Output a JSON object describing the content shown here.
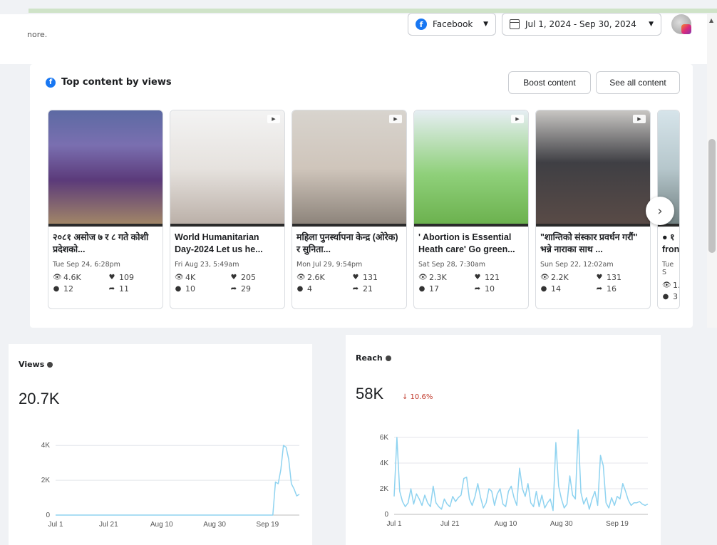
{
  "header": {
    "more_text": "nore.",
    "platform": "Facebook",
    "date_range": "Jul 1, 2024 - Sep 30, 2024"
  },
  "top_content": {
    "title": "Top content by views",
    "boost_label": "Boost content",
    "see_all_label": "See all content",
    "cards": [
      {
        "title": "२०८१ असोज ७ र ८ गते कोशी प्रदेशको...",
        "date": "Tue Sep 24, 6:28pm",
        "views": "4.6K",
        "reactions": "109",
        "comments": "12",
        "shares": "11"
      },
      {
        "title": "World Humanitarian Day-2024 Let us he...",
        "date": "Fri Aug 23, 5:49am",
        "views": "4K",
        "reactions": "205",
        "comments": "10",
        "shares": "29"
      },
      {
        "title": "महिला पुनर्स्थापना केन्द्र (ओरेक) र सुनिता...",
        "date": "Mon Jul 29, 9:54pm",
        "views": "2.6K",
        "reactions": "131",
        "comments": "4",
        "shares": "21"
      },
      {
        "title": "' Abortion is Essential Heath care' Go green...",
        "date": "Sat Sep 28, 7:30am",
        "views": "2.3K",
        "reactions": "121",
        "comments": "17",
        "shares": "10"
      },
      {
        "title": "\"शान्तिको संस्कार प्रवर्धन गरौं\" भन्ने नाराका साथ ...",
        "date": "Sun Sep 22, 12:02am",
        "views": "2.2K",
        "reactions": "131",
        "comments": "14",
        "shares": "16"
      },
      {
        "title": "● १ fron",
        "date": "Tue S",
        "views": "1.",
        "reactions": "",
        "comments": "3",
        "shares": ""
      }
    ]
  },
  "views": {
    "title": "Views",
    "value": "20.7K"
  },
  "reach": {
    "title": "Reach",
    "value": "58K",
    "delta": "↓ 10.6%"
  },
  "colors": {
    "accent": "#1877f2",
    "line": "#8fd3f0",
    "negative": "#c0392b"
  },
  "chart_data": [
    {
      "type": "line",
      "title": "Views",
      "x_ticks": [
        "Jul 1",
        "Jul 21",
        "Aug 10",
        "Aug 30",
        "Sep 19"
      ],
      "y_ticks": [
        "0",
        "2K",
        "4K"
      ],
      "ylim": [
        0,
        4500
      ],
      "x_start": "2024-07-01",
      "values": [
        0,
        0,
        0,
        0,
        0,
        0,
        0,
        0,
        0,
        0,
        0,
        0,
        0,
        0,
        0,
        0,
        0,
        0,
        0,
        0,
        0,
        0,
        0,
        0,
        0,
        0,
        0,
        0,
        0,
        0,
        0,
        0,
        0,
        0,
        0,
        0,
        0,
        0,
        0,
        0,
        0,
        0,
        0,
        0,
        0,
        0,
        0,
        0,
        0,
        0,
        0,
        0,
        0,
        0,
        0,
        0,
        0,
        0,
        0,
        0,
        0,
        0,
        0,
        0,
        0,
        0,
        0,
        0,
        0,
        0,
        0,
        0,
        0,
        0,
        0,
        0,
        0,
        0,
        0,
        0,
        0,
        0,
        0,
        1900,
        1800,
        2600,
        4000,
        3900,
        3200,
        1800,
        1500,
        1100,
        1200
      ]
    },
    {
      "type": "line",
      "title": "Reach",
      "x_ticks": [
        "Jul 1",
        "Jul 21",
        "Aug 10",
        "Aug 30",
        "Sep 19"
      ],
      "y_ticks": [
        "0",
        "2K",
        "4K",
        "6K"
      ],
      "ylim": [
        0,
        6500
      ],
      "x_start": "2024-07-01",
      "values": [
        1400,
        6000,
        1800,
        1000,
        600,
        900,
        2000,
        800,
        1600,
        1200,
        700,
        1500,
        900,
        600,
        2200,
        900,
        600,
        400,
        1200,
        800,
        600,
        1400,
        1000,
        1300,
        1500,
        2800,
        2900,
        1200,
        700,
        1400,
        2400,
        1300,
        500,
        900,
        2000,
        1800,
        700,
        1600,
        2000,
        800,
        600,
        1800,
        2200,
        1300,
        700,
        3600,
        2000,
        1400,
        2400,
        900,
        600,
        1800,
        600,
        1500,
        500,
        900,
        1200,
        300,
        5600,
        2200,
        1200,
        500,
        800,
        3000,
        1500,
        1200,
        6600,
        1700,
        800,
        1300,
        400,
        1200,
        1800,
        700,
        4600,
        3800,
        900,
        500,
        1300,
        700,
        1400,
        1200,
        2400,
        1800,
        1100,
        700,
        900,
        900,
        1000,
        800,
        700,
        800
      ]
    }
  ]
}
